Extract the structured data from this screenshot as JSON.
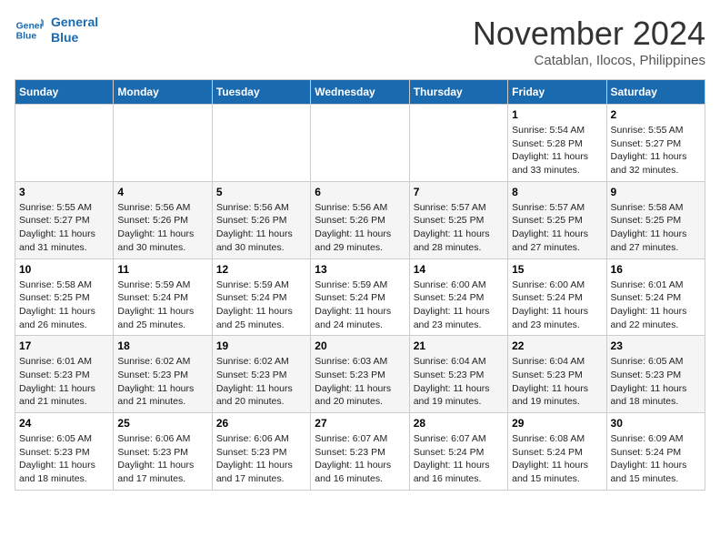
{
  "header": {
    "logo_line1": "General",
    "logo_line2": "Blue",
    "month": "November 2024",
    "location": "Catablan, Ilocos, Philippines"
  },
  "weekdays": [
    "Sunday",
    "Monday",
    "Tuesday",
    "Wednesday",
    "Thursday",
    "Friday",
    "Saturday"
  ],
  "weeks": [
    [
      {
        "day": "",
        "info": ""
      },
      {
        "day": "",
        "info": ""
      },
      {
        "day": "",
        "info": ""
      },
      {
        "day": "",
        "info": ""
      },
      {
        "day": "",
        "info": ""
      },
      {
        "day": "1",
        "info": "Sunrise: 5:54 AM\nSunset: 5:28 PM\nDaylight: 11 hours and 33 minutes."
      },
      {
        "day": "2",
        "info": "Sunrise: 5:55 AM\nSunset: 5:27 PM\nDaylight: 11 hours and 32 minutes."
      }
    ],
    [
      {
        "day": "3",
        "info": "Sunrise: 5:55 AM\nSunset: 5:27 PM\nDaylight: 11 hours and 31 minutes."
      },
      {
        "day": "4",
        "info": "Sunrise: 5:56 AM\nSunset: 5:26 PM\nDaylight: 11 hours and 30 minutes."
      },
      {
        "day": "5",
        "info": "Sunrise: 5:56 AM\nSunset: 5:26 PM\nDaylight: 11 hours and 30 minutes."
      },
      {
        "day": "6",
        "info": "Sunrise: 5:56 AM\nSunset: 5:26 PM\nDaylight: 11 hours and 29 minutes."
      },
      {
        "day": "7",
        "info": "Sunrise: 5:57 AM\nSunset: 5:25 PM\nDaylight: 11 hours and 28 minutes."
      },
      {
        "day": "8",
        "info": "Sunrise: 5:57 AM\nSunset: 5:25 PM\nDaylight: 11 hours and 27 minutes."
      },
      {
        "day": "9",
        "info": "Sunrise: 5:58 AM\nSunset: 5:25 PM\nDaylight: 11 hours and 27 minutes."
      }
    ],
    [
      {
        "day": "10",
        "info": "Sunrise: 5:58 AM\nSunset: 5:25 PM\nDaylight: 11 hours and 26 minutes."
      },
      {
        "day": "11",
        "info": "Sunrise: 5:59 AM\nSunset: 5:24 PM\nDaylight: 11 hours and 25 minutes."
      },
      {
        "day": "12",
        "info": "Sunrise: 5:59 AM\nSunset: 5:24 PM\nDaylight: 11 hours and 25 minutes."
      },
      {
        "day": "13",
        "info": "Sunrise: 5:59 AM\nSunset: 5:24 PM\nDaylight: 11 hours and 24 minutes."
      },
      {
        "day": "14",
        "info": "Sunrise: 6:00 AM\nSunset: 5:24 PM\nDaylight: 11 hours and 23 minutes."
      },
      {
        "day": "15",
        "info": "Sunrise: 6:00 AM\nSunset: 5:24 PM\nDaylight: 11 hours and 23 minutes."
      },
      {
        "day": "16",
        "info": "Sunrise: 6:01 AM\nSunset: 5:24 PM\nDaylight: 11 hours and 22 minutes."
      }
    ],
    [
      {
        "day": "17",
        "info": "Sunrise: 6:01 AM\nSunset: 5:23 PM\nDaylight: 11 hours and 21 minutes."
      },
      {
        "day": "18",
        "info": "Sunrise: 6:02 AM\nSunset: 5:23 PM\nDaylight: 11 hours and 21 minutes."
      },
      {
        "day": "19",
        "info": "Sunrise: 6:02 AM\nSunset: 5:23 PM\nDaylight: 11 hours and 20 minutes."
      },
      {
        "day": "20",
        "info": "Sunrise: 6:03 AM\nSunset: 5:23 PM\nDaylight: 11 hours and 20 minutes."
      },
      {
        "day": "21",
        "info": "Sunrise: 6:04 AM\nSunset: 5:23 PM\nDaylight: 11 hours and 19 minutes."
      },
      {
        "day": "22",
        "info": "Sunrise: 6:04 AM\nSunset: 5:23 PM\nDaylight: 11 hours and 19 minutes."
      },
      {
        "day": "23",
        "info": "Sunrise: 6:05 AM\nSunset: 5:23 PM\nDaylight: 11 hours and 18 minutes."
      }
    ],
    [
      {
        "day": "24",
        "info": "Sunrise: 6:05 AM\nSunset: 5:23 PM\nDaylight: 11 hours and 18 minutes."
      },
      {
        "day": "25",
        "info": "Sunrise: 6:06 AM\nSunset: 5:23 PM\nDaylight: 11 hours and 17 minutes."
      },
      {
        "day": "26",
        "info": "Sunrise: 6:06 AM\nSunset: 5:23 PM\nDaylight: 11 hours and 17 minutes."
      },
      {
        "day": "27",
        "info": "Sunrise: 6:07 AM\nSunset: 5:23 PM\nDaylight: 11 hours and 16 minutes."
      },
      {
        "day": "28",
        "info": "Sunrise: 6:07 AM\nSunset: 5:24 PM\nDaylight: 11 hours and 16 minutes."
      },
      {
        "day": "29",
        "info": "Sunrise: 6:08 AM\nSunset: 5:24 PM\nDaylight: 11 hours and 15 minutes."
      },
      {
        "day": "30",
        "info": "Sunrise: 6:09 AM\nSunset: 5:24 PM\nDaylight: 11 hours and 15 minutes."
      }
    ]
  ]
}
